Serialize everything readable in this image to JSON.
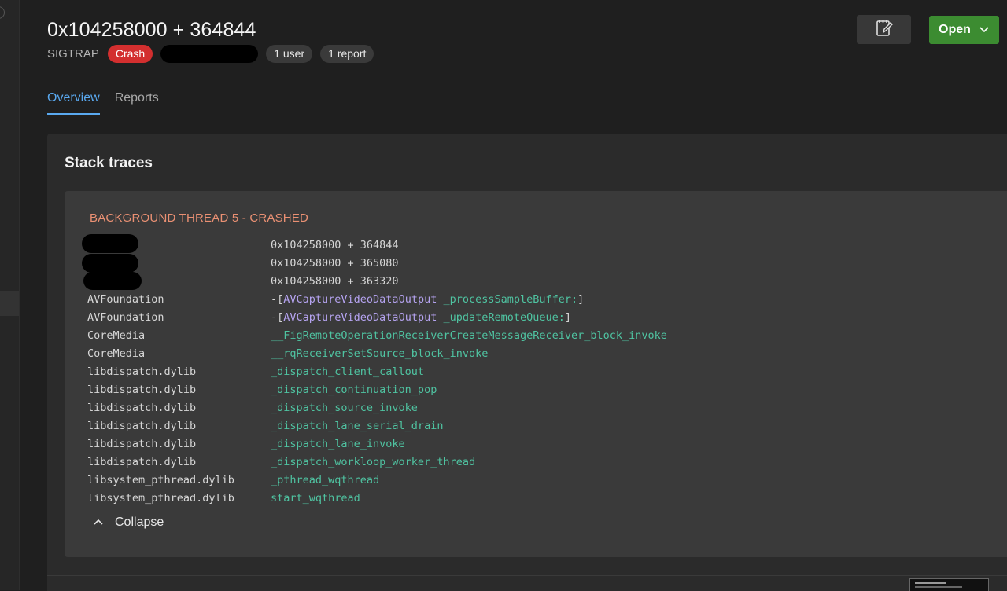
{
  "header": {
    "title": "0x104258000 + 364844",
    "signal": "SIGTRAP",
    "badges": {
      "crash": "Crash",
      "users": "1 user",
      "reports": "1 report"
    }
  },
  "tabs": [
    {
      "label": "Overview",
      "active": true
    },
    {
      "label": "Reports",
      "active": false
    }
  ],
  "toolbar": {
    "note_icon": "note-edit-icon",
    "open_label": "Open",
    "open_icon": "chevron-down-icon"
  },
  "stack_traces": {
    "title": "Stack traces",
    "thread_title": "BACKGROUND THREAD 5 - CRASHED",
    "frames": [
      {
        "lib": "",
        "sym": "0x104258000 + 364844"
      },
      {
        "lib": "",
        "sym": "0x104258000 + 365080"
      },
      {
        "lib": "",
        "sym": "0x104258000 + 363320"
      },
      {
        "lib": "AVFoundation",
        "prefix": "-[",
        "cls": "AVCaptureVideoDataOutput",
        "method": " _processSampleBuffer:",
        "suffix": "]"
      },
      {
        "lib": "AVFoundation",
        "prefix": "-[",
        "cls": "AVCaptureVideoDataOutput",
        "method": " _updateRemoteQueue:",
        "suffix": "]"
      },
      {
        "lib": "CoreMedia",
        "sym": "__FigRemoteOperationReceiverCreateMessageReceiver_block_invoke"
      },
      {
        "lib": "CoreMedia",
        "sym": "__rqReceiverSetSource_block_invoke"
      },
      {
        "lib": "libdispatch.dylib",
        "sym": "_dispatch_client_callout"
      },
      {
        "lib": "libdispatch.dylib",
        "sym": "_dispatch_continuation_pop"
      },
      {
        "lib": "libdispatch.dylib",
        "sym": "_dispatch_source_invoke"
      },
      {
        "lib": "libdispatch.dylib",
        "sym": "_dispatch_lane_serial_drain"
      },
      {
        "lib": "libdispatch.dylib",
        "sym": "_dispatch_lane_invoke"
      },
      {
        "lib": "libdispatch.dylib",
        "sym": "_dispatch_workloop_worker_thread"
      },
      {
        "lib": "libsystem_pthread.dylib",
        "sym": "_pthread_wqthread"
      },
      {
        "lib": "libsystem_pthread.dylib",
        "sym": "start_wqthread"
      }
    ],
    "collapse_label": "Collapse",
    "collapse_icon": "chevron-up-icon"
  },
  "colors": {
    "crash_badge": "#d32f2f",
    "open_button": "#3c8c31",
    "active_tab": "#5aa9f0",
    "thread_title": "#ea9073",
    "function_symbol": "#4fc3a1",
    "class_symbol": "#b5a3f0"
  }
}
